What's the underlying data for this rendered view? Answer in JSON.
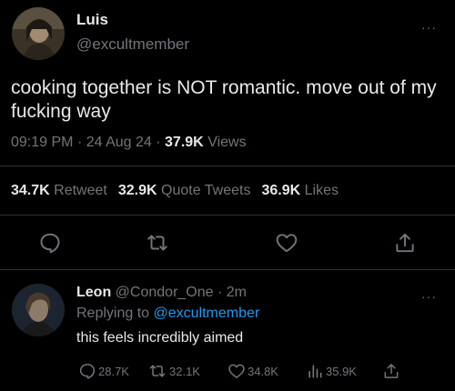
{
  "tweet": {
    "display_name": "Luis",
    "handle": "@excultmember",
    "text": "cooking together is NOT romantic. move out of my fucking way",
    "time": "09:19 PM",
    "sep1": "·",
    "date": "24 Aug 24",
    "sep2": "·",
    "views_count": "37.9K",
    "views_label": "Views",
    "more": "···"
  },
  "stats": {
    "retweets_count": "34.7K",
    "retweets_label": "Retweet",
    "quotes_count": "32.9K",
    "quotes_label": "Quote Tweets",
    "likes_count": "36.9K",
    "likes_label": "Likes"
  },
  "actions": [
    "reply-icon",
    "retweet-icon",
    "like-icon",
    "share-icon"
  ],
  "reply": {
    "display_name": "Leon",
    "handle": "@Condor_One",
    "sep": "·",
    "age": "2m",
    "replying_prefix": "Replying to",
    "replying_handle": "@excultmember",
    "text": "this feels incredibly aimed",
    "more": "···",
    "reply_count": "28.7K",
    "retweet_count": "32.1K",
    "like_count": "34.8K",
    "view_count": "35.9K"
  },
  "colors": {
    "background": "#000000",
    "text": "#e7e9ea",
    "muted": "#71767b",
    "link": "#1d9bf0",
    "divider": "#2f3336"
  }
}
